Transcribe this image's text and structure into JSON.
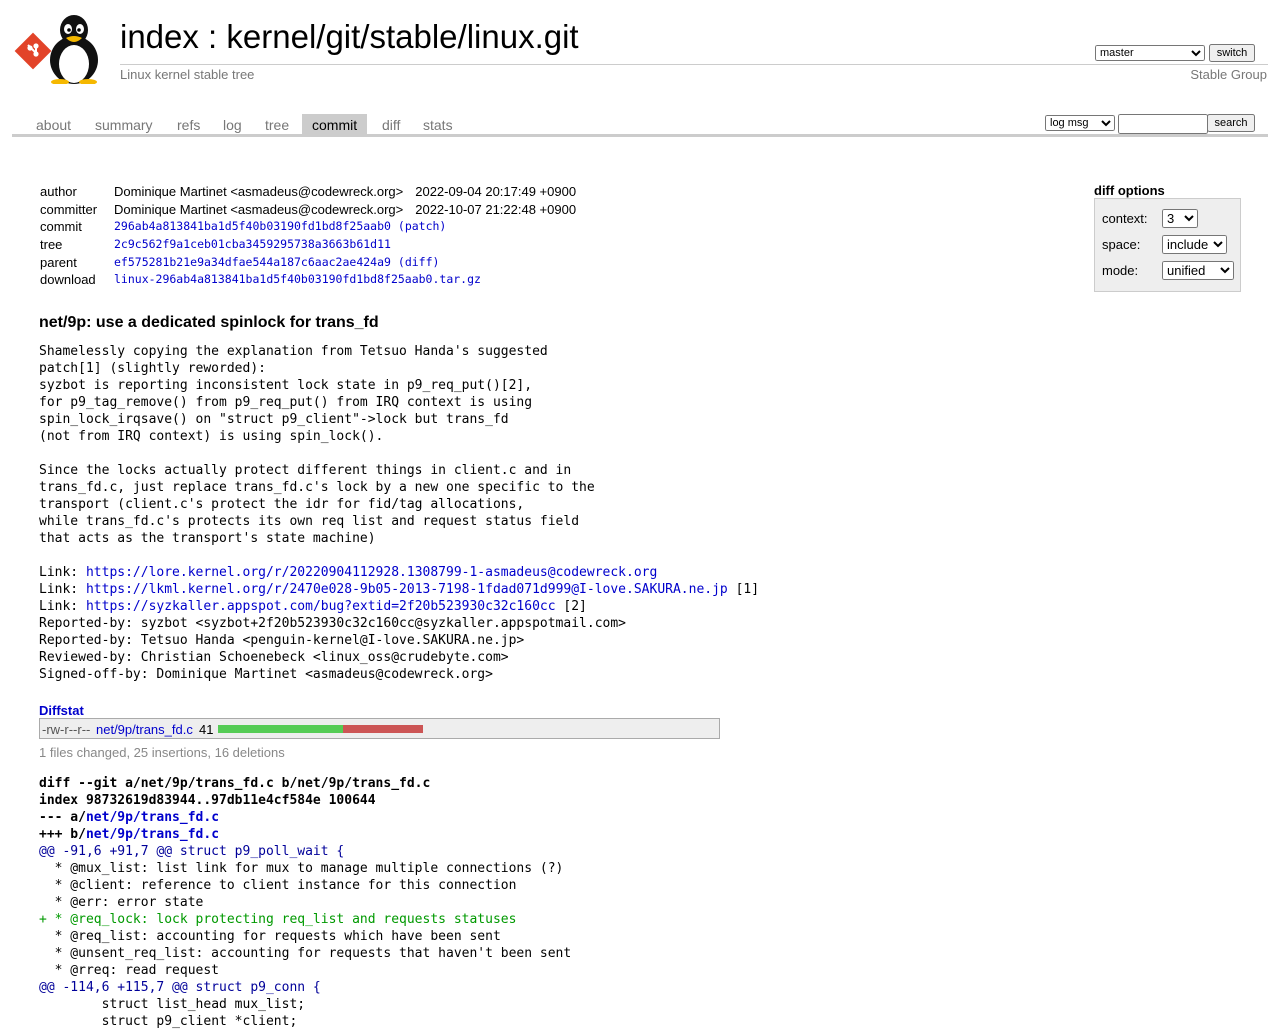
{
  "header": {
    "title_index": "index",
    "title_sep": " : ",
    "title_repo": "kernel/git/stable/linux.git",
    "subtitle": "Linux kernel stable tree",
    "branch": "master",
    "switch_label": "switch",
    "owner": "Stable Group",
    "icons": [
      "git-logo-icon",
      "tux-penguin-icon"
    ]
  },
  "tabs": [
    {
      "label": "about",
      "active": false
    },
    {
      "label": "summary",
      "active": false
    },
    {
      "label": "refs",
      "active": false
    },
    {
      "label": "log",
      "active": false
    },
    {
      "label": "tree",
      "active": false
    },
    {
      "label": "commit",
      "active": true
    },
    {
      "label": "diff",
      "active": false
    },
    {
      "label": "stats",
      "active": false
    }
  ],
  "search": {
    "type_selected": "log msg",
    "query": "",
    "button_label": "search"
  },
  "commit_info": {
    "author_label": "author",
    "author": "Dominique Martinet <asmadeus@codewreck.org>",
    "author_date": "2022-09-04 20:17:49 +0900",
    "committer_label": "committer",
    "committer": "Dominique Martinet <asmadeus@codewreck.org>",
    "committer_date": "2022-10-07 21:22:48 +0900",
    "commit_label": "commit",
    "commit_hash": "296ab4a813841ba1d5f40b03190fd1bd8f25aab0",
    "commit_link": "(patch)",
    "tree_label": "tree",
    "tree_hash": "2c9c562f9a1ceb01cba3459295738a3663b61d11",
    "parent_label": "parent",
    "parent_hash": "ef575281b21e9a34dfae544a187c6aac2ae424a9",
    "parent_link": "(diff)",
    "download_label": "download",
    "download_file": "linux-296ab4a813841ba1d5f40b03190fd1bd8f25aab0.tar.gz"
  },
  "diff_options": {
    "title": "diff options",
    "context_label": "context:",
    "context_value": "3",
    "space_label": "space:",
    "space_value": "include",
    "mode_label": "mode:",
    "mode_value": "unified"
  },
  "message": {
    "subject": "net/9p: use a dedicated spinlock for trans_fd",
    "body": [
      "Shamelessly copying the explanation from Tetsuo Handa's suggested",
      "patch[1] (slightly reworded):",
      "syzbot is reporting inconsistent lock state in p9_req_put()[2],",
      "for p9_tag_remove() from p9_req_put() from IRQ context is using",
      "spin_lock_irqsave() on \"struct p9_client\"->lock but trans_fd",
      "(not from IRQ context) is using spin_lock().",
      "",
      "Since the locks actually protect different things in client.c and in",
      "trans_fd.c, just replace trans_fd.c's lock by a new one specific to the",
      "transport (client.c's protect the idr for fid/tag allocations,",
      "while trans_fd.c's protects its own req list and request status field",
      "that acts as the transport's state machine)",
      ""
    ],
    "links": [
      {
        "prefix": "Link: ",
        "url": "https://lore.kernel.org/r/20220904112928.1308799-1-asmadeus@codewreck.org",
        "suffix": ""
      },
      {
        "prefix": "Link: ",
        "url": "https://lkml.kernel.org/r/2470e028-9b05-2013-7198-1fdad071d999@I-love.SAKURA.ne.jp",
        "suffix": " [1]"
      },
      {
        "prefix": "Link: ",
        "url": "https://syzkaller.appspot.com/bug?extid=2f20b523930c32c160cc",
        "suffix": " [2]"
      }
    ],
    "trailers": [
      "Reported-by: syzbot <syzbot+2f20b523930c32c160cc@syzkaller.appspotmail.com>",
      "Reported-by: Tetsuo Handa <penguin-kernel@I-love.SAKURA.ne.jp>",
      "Reviewed-by: Christian Schoenebeck <linux_oss@crudebyte.com>",
      "Signed-off-by: Dominique Martinet <asmadeus@codewreck.org>"
    ]
  },
  "diffstat": {
    "title": "Diffstat",
    "mode": "-rw-r--r--",
    "file": "net/9p/trans_fd.c",
    "count": "41",
    "insertions": 25,
    "deletions": 16,
    "summary": "1 files changed, 25 insertions, 16 deletions"
  },
  "diff": {
    "lines": [
      {
        "type": "head",
        "text": "diff --git a/net/9p/trans_fd.c b/net/9p/trans_fd.c"
      },
      {
        "type": "head",
        "text": "index 98732619d83944..97db11e4cf584e 100644"
      },
      {
        "type": "head",
        "prefix": "--- a/",
        "path": "net/9p/trans_fd.c"
      },
      {
        "type": "head",
        "prefix": "+++ b/",
        "path": "net/9p/trans_fd.c"
      },
      {
        "type": "hunk",
        "text": "@@ -91,6 +91,7 @@ struct p9_poll_wait {"
      },
      {
        "type": "ctx",
        "text": "  * @mux_list: list link for mux to manage multiple connections (?)"
      },
      {
        "type": "ctx",
        "text": "  * @client: reference to client instance for this connection"
      },
      {
        "type": "ctx",
        "text": "  * @err: error state"
      },
      {
        "type": "add",
        "text": "+ * @req_lock: lock protecting req_list and requests statuses"
      },
      {
        "type": "ctx",
        "text": "  * @req_list: accounting for requests which have been sent"
      },
      {
        "type": "ctx",
        "text": "  * @unsent_req_list: accounting for requests that haven't been sent"
      },
      {
        "type": "ctx",
        "text": "  * @rreq: read request"
      },
      {
        "type": "hunk",
        "text": "@@ -114,6 +115,7 @@ struct p9_conn {"
      },
      {
        "type": "ctx",
        "text": " \tstruct list_head mux_list;"
      },
      {
        "type": "ctx",
        "text": " \tstruct p9_client *client;"
      }
    ]
  }
}
